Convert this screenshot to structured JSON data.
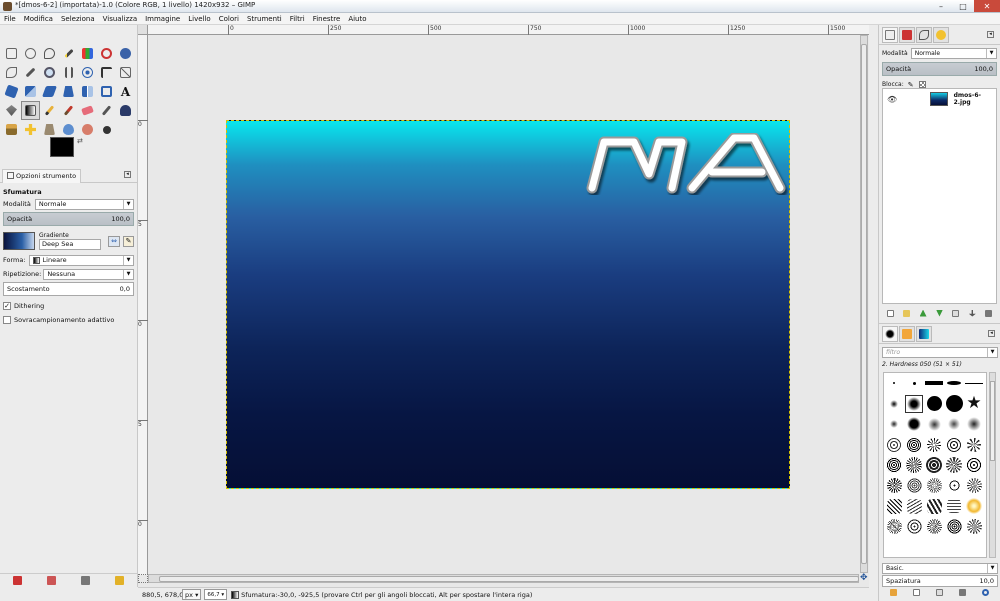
{
  "window": {
    "title": "*[dmos-6-2] (importata)-1.0 (Colore RGB, 1 livello) 1420x932 – GIMP",
    "minimize": "–",
    "maximize": "□",
    "close": "✕"
  },
  "menu": [
    "File",
    "Modifica",
    "Seleziona",
    "Visualizza",
    "Immagine",
    "Livello",
    "Colori",
    "Strumenti",
    "Filtri",
    "Finestre",
    "Aiuto"
  ],
  "tool_options": {
    "tab_label": "Opzioni strumento",
    "tool_name": "Sfumatura",
    "mode_label": "Modalità",
    "mode_value": "Normale",
    "opacity_label": "Opacità",
    "opacity_value": "100,0",
    "gradient_label": "Gradiente",
    "gradient_value": "Deep Sea",
    "shape_label": "Forma:",
    "shape_value": "Lineare",
    "repeat_label": "Ripetizione:",
    "repeat_value": "Nessuna",
    "offset_label": "Scostamento",
    "offset_value": "0,0",
    "dithering_label": "Dithering",
    "dithering_checked": true,
    "supersampling_label": "Sovracampionamento adattivo",
    "supersampling_checked": false
  },
  "rulers": {
    "top": [
      "0",
      "250",
      "500",
      "750",
      "1000",
      "1250",
      "1500"
    ],
    "left": [
      "0",
      "5",
      "0",
      "5",
      "0"
    ]
  },
  "logo_text": "MA",
  "status": {
    "coords": "880,5, 678,0",
    "unit": "px",
    "zoom": "66,7",
    "message": "Sfumatura:-30,0, -925,5 (provare Ctrl per gli angoli bloccati, Alt per spostare l'intera riga)"
  },
  "layers": {
    "mode_label": "Modalità",
    "mode_value": "Normale",
    "opacity_label": "Opacità",
    "opacity_value": "100,0",
    "lock_label": "Blocca:",
    "layer_name": "dmos-6-2.jpg"
  },
  "brushes": {
    "filter_placeholder": "filtro",
    "selected_brush": "2. Hardness 050 (51 × 51)",
    "preset_value": "Basic.",
    "spacing_label": "Spaziatura",
    "spacing_value": "10,0"
  },
  "colors": {
    "accent": "#295fa2",
    "gradient_top": "#08e7ee",
    "gradient_bottom": "#050f35"
  }
}
